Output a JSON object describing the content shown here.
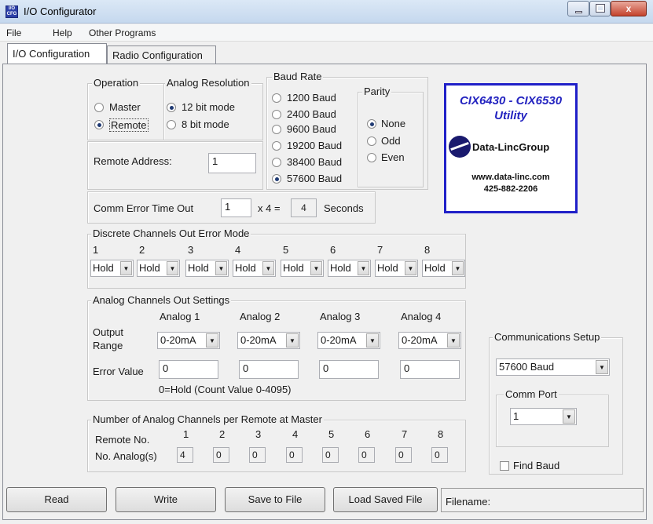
{
  "window": {
    "title": "I/O Configurator",
    "close": "x"
  },
  "menu": {
    "file": "File",
    "help": "Help",
    "other": "Other Programs"
  },
  "tabs": [
    "I/O Configuration",
    "Radio Configuration"
  ],
  "operation": {
    "label": "Operation",
    "master": "Master",
    "remote": "Remote",
    "selected": "Remote"
  },
  "analog_resolution": {
    "label": "Analog Resolution",
    "opt12": "12 bit mode",
    "opt8": "8 bit mode",
    "selected": "12 bit mode"
  },
  "remote_address": {
    "label": "Remote Address:",
    "value": "1"
  },
  "comm_error": {
    "label": "Comm Error Time Out",
    "value": "1",
    "mult": "x 4 =",
    "result": "4",
    "unit": "Seconds"
  },
  "baud_rate": {
    "label": "Baud Rate",
    "options": [
      "1200 Baud",
      "2400 Baud",
      "9600 Baud",
      "19200 Baud",
      "38400 Baud",
      "57600 Baud"
    ],
    "selected": "57600 Baud"
  },
  "parity": {
    "label": "Parity",
    "options": [
      "None",
      "Odd",
      "Even"
    ],
    "selected": "None"
  },
  "logo": {
    "model": "CIX6430 - CIX6530",
    "utility": "Utility",
    "company": "Data-LincGroup",
    "web": "www.data-linc.com",
    "phone": "425-882-2206"
  },
  "discrete": {
    "label": "Discrete Channels Out Error Mode",
    "channels": [
      "1",
      "2",
      "3",
      "4",
      "5",
      "6",
      "7",
      "8"
    ],
    "values": [
      "Hold",
      "Hold",
      "Hold",
      "Hold",
      "Hold",
      "Hold",
      "Hold",
      "Hold"
    ]
  },
  "analog_out": {
    "label": "Analog Channels Out Settings",
    "channels": [
      "Analog 1",
      "Analog 2",
      "Analog 3",
      "Analog 4"
    ],
    "output_label1": "Output",
    "output_label2": "Range",
    "ranges": [
      "0-20mA",
      "0-20mA",
      "0-20mA",
      "0-20mA"
    ],
    "error_label": "Error Value",
    "errors": [
      "0",
      "0",
      "0",
      "0"
    ],
    "note": "0=Hold (Count Value 0-4095)"
  },
  "num_analog": {
    "label": "Number of Analog Channels per Remote at Master",
    "remote_label": "Remote No.",
    "count_label": "No. Analog(s)",
    "remotes": [
      "1",
      "2",
      "3",
      "4",
      "5",
      "6",
      "7",
      "8"
    ],
    "counts": [
      "4",
      "0",
      "0",
      "0",
      "0",
      "0",
      "0",
      "0"
    ]
  },
  "comm_setup": {
    "label": "Communications Setup",
    "baud": "57600 Baud",
    "port_label": "Comm Port",
    "port": "1",
    "find_baud": "Find Baud"
  },
  "buttons": {
    "read": "Read",
    "write": "Write",
    "save": "Save to File",
    "load": "Load Saved File"
  },
  "filename": {
    "label": "Filename:"
  }
}
